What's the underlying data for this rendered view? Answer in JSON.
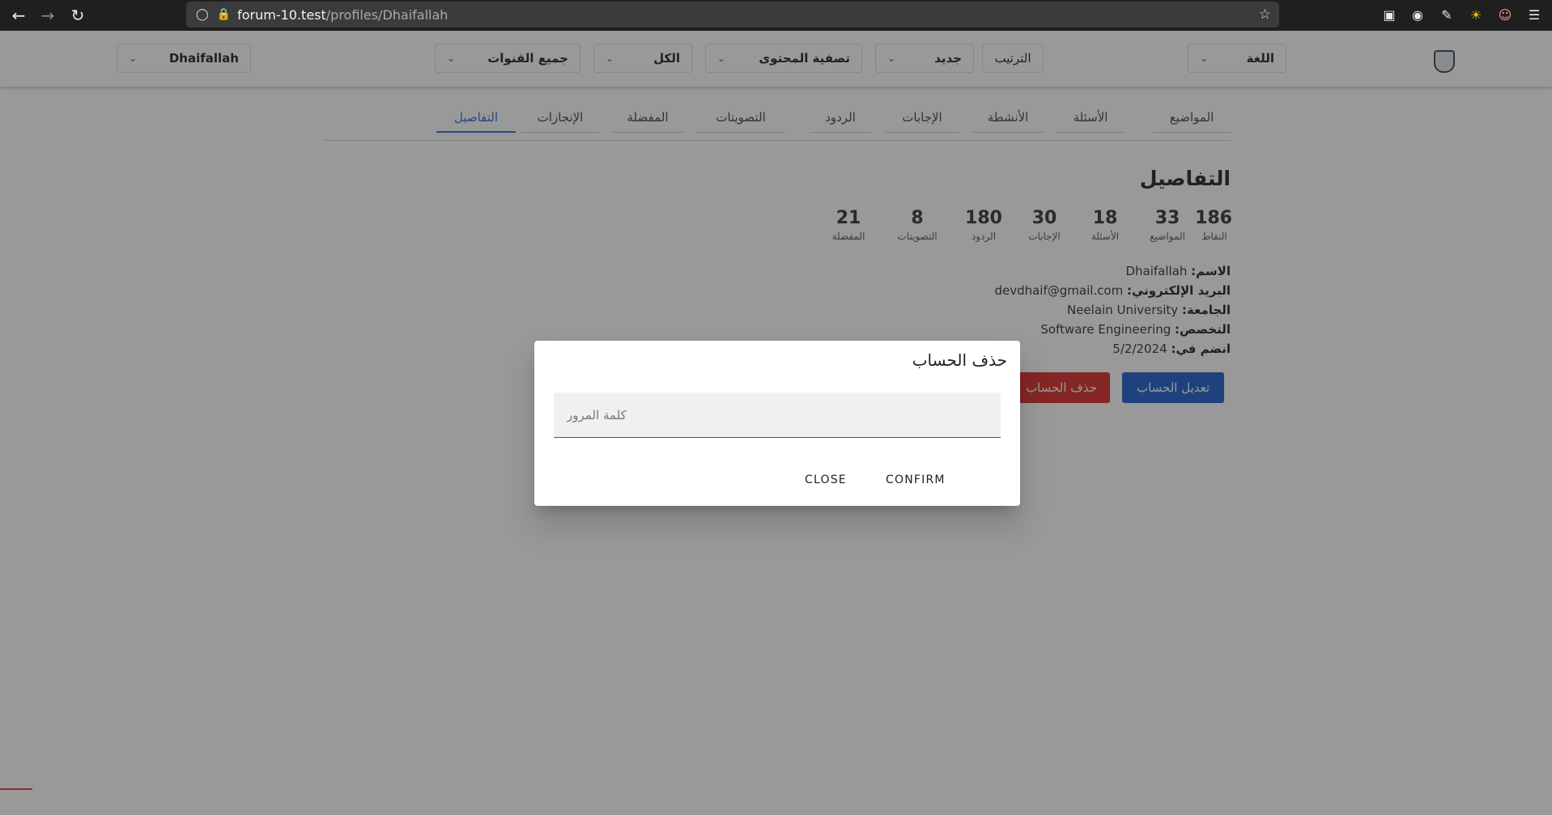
{
  "browser": {
    "url_host": "forum-10.test",
    "url_path": "/profiles/Dhaifallah"
  },
  "header": {
    "language": "اللغة",
    "sort_label": "الترتيب",
    "sort_value": "جديد",
    "filter": "تصفية المحتوى",
    "all": "الكل",
    "channels": "جميع القنوات",
    "user": "Dhaifallah"
  },
  "tabs": [
    "المواضيع",
    "الأسئلة",
    "الأنشطة",
    "الإجابات",
    "الردود",
    "التصويتات",
    "المفضلة",
    "الإنجازات",
    "التفاصيل"
  ],
  "details": {
    "title": "التفاصيل",
    "stats": [
      {
        "value": "186",
        "label": "النقاط"
      },
      {
        "value": "33",
        "label": "المواضيع"
      },
      {
        "value": "18",
        "label": "الأسئلة"
      },
      {
        "value": "30",
        "label": "الإجابات"
      },
      {
        "value": "180",
        "label": "الردود"
      },
      {
        "value": "8",
        "label": "التصويتات"
      },
      {
        "value": "21",
        "label": "المفضلة"
      }
    ],
    "info": [
      {
        "label": "الاسم:",
        "value": "Dhaifallah"
      },
      {
        "label": "البريد الإلكتروني:",
        "value": "devdhaif@gmail.com"
      },
      {
        "label": "الجامعة:",
        "value": "Neelain University"
      },
      {
        "label": "التخصص:",
        "value": "Software Engineering"
      },
      {
        "label": "انضم في:",
        "value": "5/2/2024"
      }
    ],
    "edit_button": "تعديل الحساب",
    "delete_button": "حذف الحساب"
  },
  "dialog": {
    "title": "حذف الحساب",
    "password_placeholder": "كلمة المرور",
    "close": "CLOSE",
    "confirm": "CONFIRM"
  },
  "colors": {
    "accent": "#2a6bd6",
    "primary_button": "#1f5fd0",
    "danger_button": "#d92b2b"
  }
}
